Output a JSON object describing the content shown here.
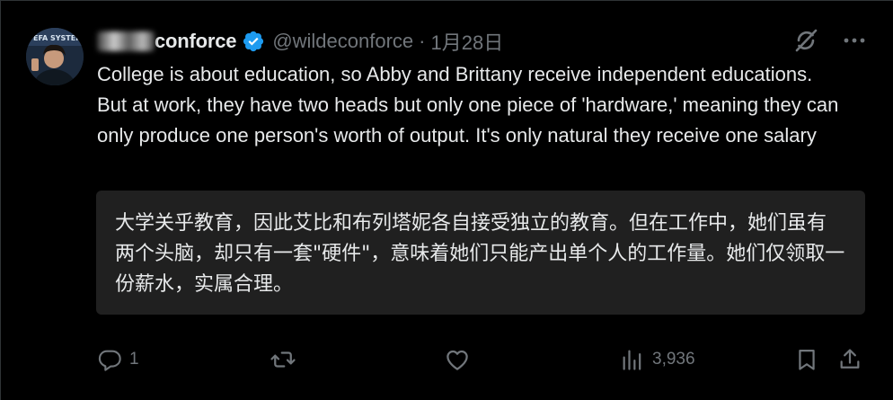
{
  "tweet": {
    "display_name": "conforce",
    "handle": "@wildeconforce",
    "separator": "·",
    "date": "1月28日",
    "text": "College is about education, so Abby and Brittany receive independent educations. But at work, they have two heads but only one piece of 'hardware,' meaning they can only produce one person's worth of output. It's only natural they receive one salary",
    "translation": "大学关乎教育，因此艾比和布列塔妮各自接受独立的教育。但在工作中，她们虽有两个头脑，却只有一套\"硬件\"，意味着她们只能产出单个人的工作量。她们仅领取一份薪水，实属合理。",
    "avatar_caption": "EFA SYSTEM"
  },
  "actions": {
    "reply_count": "1",
    "repost_count": "",
    "like_count": "",
    "view_count": "3,936"
  },
  "colors": {
    "background": "#000000",
    "text": "#e7e9ea",
    "muted": "#71767b",
    "verified": "#1d9bf0",
    "translation_bg": "#202020"
  },
  "icons": [
    "verified-badge-icon",
    "grok-icon",
    "more-icon",
    "reply-icon",
    "repost-icon",
    "like-icon",
    "views-icon",
    "bookmark-icon",
    "share-icon"
  ]
}
